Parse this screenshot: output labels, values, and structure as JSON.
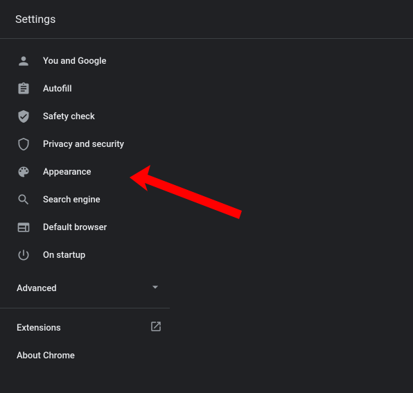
{
  "header": {
    "title": "Settings"
  },
  "sidebar": {
    "items": [
      {
        "icon": "person-icon",
        "label": "You and Google"
      },
      {
        "icon": "autofill-icon",
        "label": "Autofill"
      },
      {
        "icon": "safety-check-icon",
        "label": "Safety check"
      },
      {
        "icon": "privacy-icon",
        "label": "Privacy and security"
      },
      {
        "icon": "appearance-icon",
        "label": "Appearance"
      },
      {
        "icon": "search-icon",
        "label": "Search engine"
      },
      {
        "icon": "browser-icon",
        "label": "Default browser"
      },
      {
        "icon": "startup-icon",
        "label": "On startup"
      }
    ],
    "advanced_label": "Advanced",
    "extensions_label": "Extensions",
    "about_label": "About Chrome"
  },
  "annotation": {
    "arrow_color": "#ff0000",
    "target": "Privacy and security"
  }
}
